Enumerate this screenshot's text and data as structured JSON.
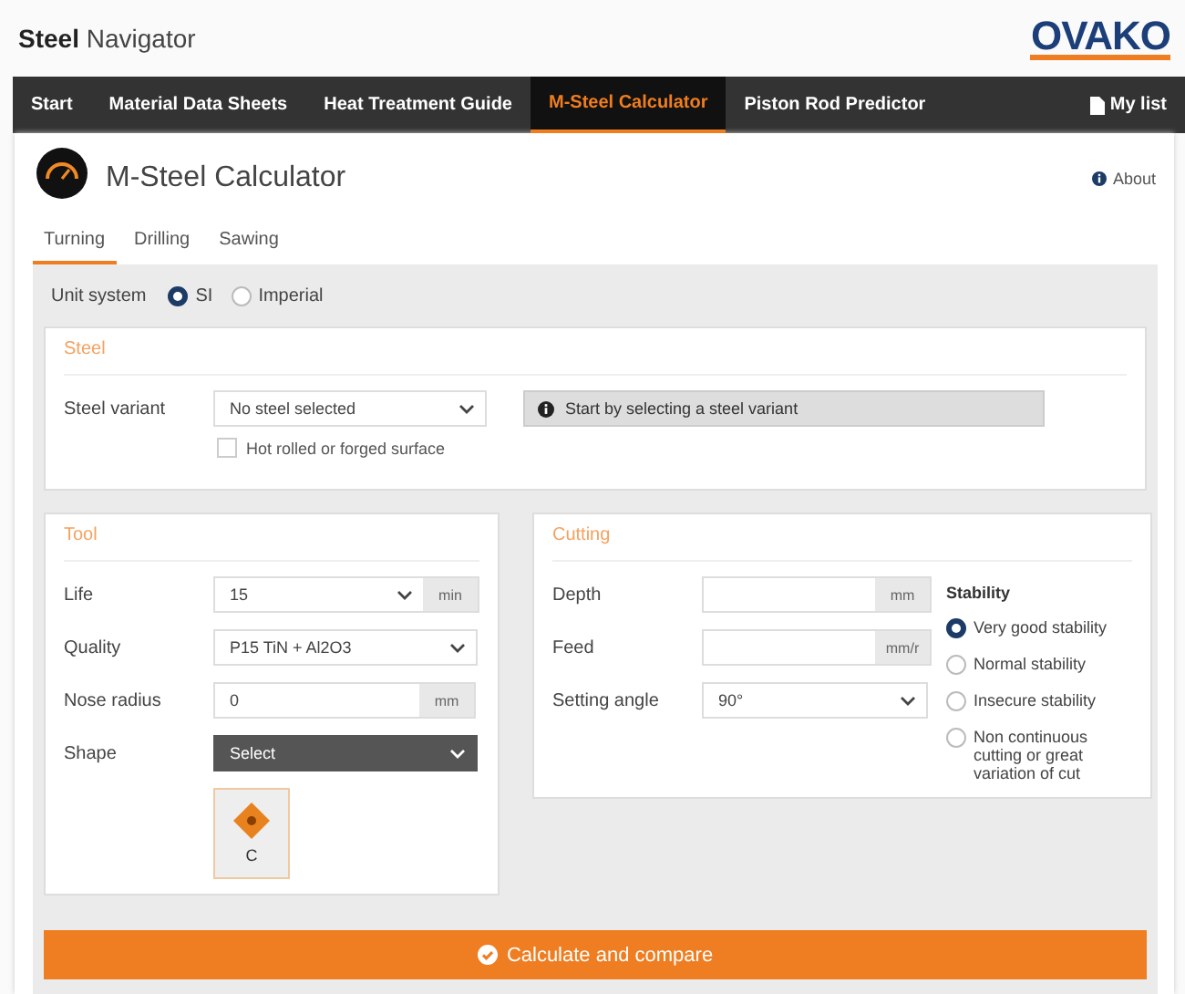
{
  "header": {
    "brand_bold": "Steel",
    "brand_rest": "Navigator",
    "logo": "OVAKO"
  },
  "nav": {
    "items": [
      {
        "label": "Start",
        "selected": false
      },
      {
        "label": "Material Data Sheets",
        "selected": false
      },
      {
        "label": "Heat Treatment Guide",
        "selected": false
      },
      {
        "label": "M-Steel Calculator",
        "selected": true
      },
      {
        "label": "Piston Rod Predictor",
        "selected": false
      }
    ],
    "my_list": "My list"
  },
  "page": {
    "title": "M-Steel Calculator",
    "about": "About"
  },
  "tabs": [
    {
      "label": "Turning",
      "selected": true
    },
    {
      "label": "Drilling",
      "selected": false
    },
    {
      "label": "Sawing",
      "selected": false
    }
  ],
  "unit_system": {
    "label": "Unit system",
    "options": [
      {
        "label": "SI",
        "selected": true
      },
      {
        "label": "Imperial",
        "selected": false
      }
    ]
  },
  "steel": {
    "heading": "Steel",
    "variant_label": "Steel variant",
    "variant_value": "No steel selected",
    "hint": "Start by selecting a steel variant",
    "surface": {
      "label": "Hot rolled or forged surface",
      "checked": false
    }
  },
  "tool": {
    "heading": "Tool",
    "rows": [
      {
        "label": "Life",
        "kind": "select-unit",
        "value": "15",
        "unit": "min"
      },
      {
        "label": "Quality",
        "kind": "select",
        "value": "P15 TiN + Al2O3"
      },
      {
        "label": "Nose radius",
        "kind": "input-unit",
        "value": "0",
        "unit": "mm"
      },
      {
        "label": "Shape",
        "kind": "dark-select",
        "value": "Select"
      }
    ],
    "shape_option": "C"
  },
  "cutting": {
    "heading": "Cutting",
    "rows": [
      {
        "label": "Depth",
        "kind": "input-unit",
        "unit": "mm"
      },
      {
        "label": "Feed",
        "kind": "input-unit",
        "unit": "mm/r"
      },
      {
        "label": "Setting angle",
        "kind": "select",
        "value": "90°"
      }
    ],
    "stability": {
      "heading": "Stability",
      "options": [
        {
          "label": "Very good stability",
          "selected": true
        },
        {
          "label": "Normal stability",
          "selected": false
        },
        {
          "label": "Insecure stability",
          "selected": false
        },
        {
          "label": "Non continuous cutting or great variation of cut",
          "selected": false
        }
      ]
    }
  },
  "calculate_button": "Calculate and compare"
}
